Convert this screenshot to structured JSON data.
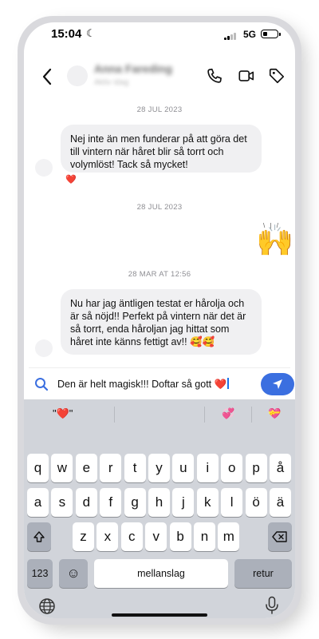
{
  "status_bar": {
    "time": "15:04",
    "network": "5G"
  },
  "header": {
    "contact_name": "Anna Fareding",
    "contact_sub": "Aktiv idag"
  },
  "messages": [
    {
      "date": "28 JUL 2023",
      "text": "Nej inte än men funderar på att göra det till vintern när håret blir så torrt och volymlöst! Tack så mycket!",
      "reaction": "❤️"
    },
    {
      "date": "28 JUL 2023",
      "sticker": "🙌"
    },
    {
      "date": "28 MAR AT 12:56",
      "text": "Nu har jag äntligen testat er hårolja och är så nöjd!! Perfekt på vintern när det är så torrt, enda håroljan jag hittat som håret inte känns fettigt av!! 🥰🥰"
    }
  ],
  "composer": {
    "text": "Den är helt magisk!!! Doftar så gott ❤️"
  },
  "keyboard": {
    "suggestions": [
      "\"❤️\"",
      "💞",
      "💝"
    ],
    "row1": [
      "q",
      "w",
      "e",
      "r",
      "t",
      "y",
      "u",
      "i",
      "o",
      "p",
      "å"
    ],
    "row2": [
      "a",
      "s",
      "d",
      "f",
      "g",
      "h",
      "j",
      "k",
      "l",
      "ö",
      "ä"
    ],
    "row3": [
      "z",
      "x",
      "c",
      "v",
      "b",
      "n",
      "m"
    ],
    "numbers_label": "123",
    "emoji_label": "☺",
    "space_label": "mellanslag",
    "return_label": "retur"
  },
  "colors": {
    "accent": "#3b6fe0",
    "bubble": "#f0f0f2",
    "keyboard_bg": "#d1d4da"
  },
  "icons": [
    "back-chevron-icon",
    "phone-icon",
    "video-icon",
    "tag-icon",
    "search-icon",
    "send-icon",
    "shift-icon",
    "backspace-icon",
    "globe-icon",
    "microphone-icon",
    "moon-icon"
  ]
}
